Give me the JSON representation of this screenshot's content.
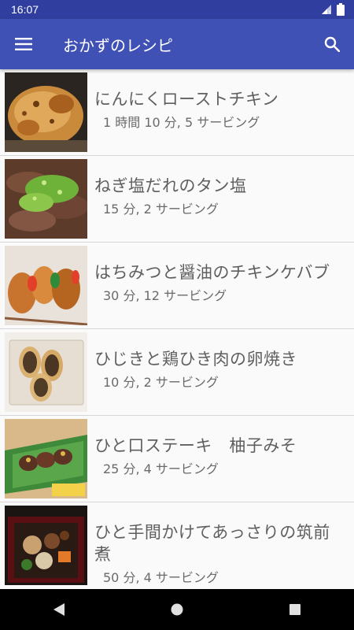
{
  "status_bar": {
    "time": "16:07"
  },
  "app_bar": {
    "title": "おかずのレシピ",
    "menu_icon": "hamburger-menu-icon",
    "search_icon": "search-icon"
  },
  "recipes": [
    {
      "name": "にんにくローストチキン",
      "meta": "1 時間 10 分, 5 サービング",
      "image": "roast-chicken-photo"
    },
    {
      "name": "ねぎ塩だれのタン塩",
      "meta": "15 分, 2 サービング",
      "image": "tongue-green-onion-photo"
    },
    {
      "name": "はちみつと醤油のチキンケバブ",
      "meta": "30 分, 12 サービング",
      "image": "chicken-kebab-photo"
    },
    {
      "name": "ひじきと鶏ひき肉の卵焼き",
      "meta": "10 分, 2 サービング",
      "image": "rolled-omelet-photo"
    },
    {
      "name": "ひと口ステーキ　柚子みそ",
      "meta": "25 分, 4 サービング",
      "image": "bite-steak-photo"
    },
    {
      "name": "ひと手間かけてあっさりの筑前煮",
      "meta": "50 分, 4 サービング",
      "image": "chikuzenni-photo"
    }
  ],
  "nav_bar": {
    "back_icon": "back-icon",
    "home_icon": "home-icon",
    "recents_icon": "recents-icon"
  },
  "colors": {
    "primary": "#3f51b5",
    "primary_dark": "#303f9f"
  }
}
